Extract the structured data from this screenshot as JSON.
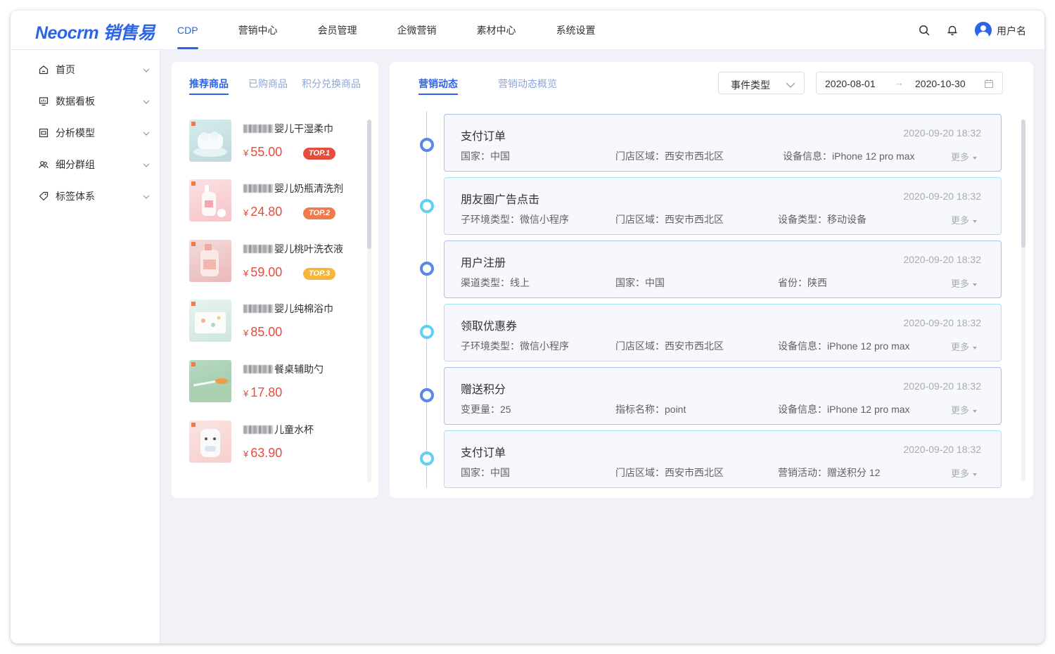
{
  "header": {
    "logo": "Neocrm 销售易",
    "nav": [
      "CDP",
      "营销中心",
      "会员管理",
      "企微营销",
      "素材中心",
      "系统设置"
    ],
    "active_nav": "CDP",
    "username": "用户名"
  },
  "sidebar": {
    "items": [
      {
        "label": "首页",
        "icon": "home-icon"
      },
      {
        "label": "数据看板",
        "icon": "monitor-icon"
      },
      {
        "label": "分析模型",
        "icon": "chart-icon"
      },
      {
        "label": "细分群组",
        "icon": "group-icon"
      },
      {
        "label": "标签体系",
        "icon": "tag-icon"
      }
    ]
  },
  "products_panel": {
    "tabs": [
      "推荐商品",
      "已购商品",
      "积分兑换商品"
    ],
    "items": [
      {
        "name": "婴儿干湿柔巾",
        "price": "55.00",
        "currency": "¥",
        "badge": "TOP.1",
        "badge_color": "#e84c3d"
      },
      {
        "name": "婴儿奶瓶清洗剂",
        "price": "24.80",
        "currency": "¥",
        "badge": "TOP.2",
        "badge_color": "#f07a4a"
      },
      {
        "name": "婴儿桃叶洗衣液",
        "price": "59.00",
        "currency": "¥",
        "badge": "TOP.3",
        "badge_color": "#f5b73a"
      },
      {
        "name": "婴儿纯棉浴巾",
        "price": "85.00",
        "currency": "¥"
      },
      {
        "name": "餐桌辅助勺",
        "price": "17.80",
        "currency": "¥"
      },
      {
        "name": "儿童水杯",
        "price": "63.90",
        "currency": "¥"
      }
    ]
  },
  "events_panel": {
    "tabs": [
      "营销动态",
      "营销动态概览"
    ],
    "event_type_placeholder": "事件类型",
    "date_start": "2020-08-01",
    "date_separator": "→",
    "date_end": "2020-10-30",
    "more_label": "更多",
    "events": [
      {
        "title": "支付订单",
        "time": "2020-09-20 18:32",
        "style": "blue",
        "fields": [
          "国家：中国",
          "门店区域：西安市西北区",
          "设备信息：iPhone 12 pro max"
        ]
      },
      {
        "title": "朋友圈广告点击",
        "time": "2020-09-20 18:32",
        "style": "cyan",
        "fields": [
          "子环境类型：微信小程序",
          "门店区域：西安市西北区",
          "设备类型：移动设备"
        ]
      },
      {
        "title": "用户注册",
        "time": "2020-09-20 18:32",
        "style": "blue",
        "fields": [
          "渠道类型：线上",
          "国家：中国",
          "省份：陕西"
        ]
      },
      {
        "title": "领取优惠券",
        "time": "2020-09-20 18:32",
        "style": "cyan",
        "fields": [
          "子环境类型：微信小程序",
          "门店区域：西安市西北区",
          "设备信息：iPhone 12 pro max"
        ]
      },
      {
        "title": "赠送积分",
        "time": "2020-09-20 18:32",
        "style": "blue",
        "fields": [
          "变更量：25",
          "指标名称：point",
          "设备信息：iPhone 12 pro max"
        ]
      },
      {
        "title": "支付订单",
        "time": "2020-09-20 18:32",
        "style": "cyan",
        "fields": [
          "国家：中国",
          "门店区域：西安市西北区",
          "营销活动：赠送积分 12"
        ]
      }
    ]
  }
}
